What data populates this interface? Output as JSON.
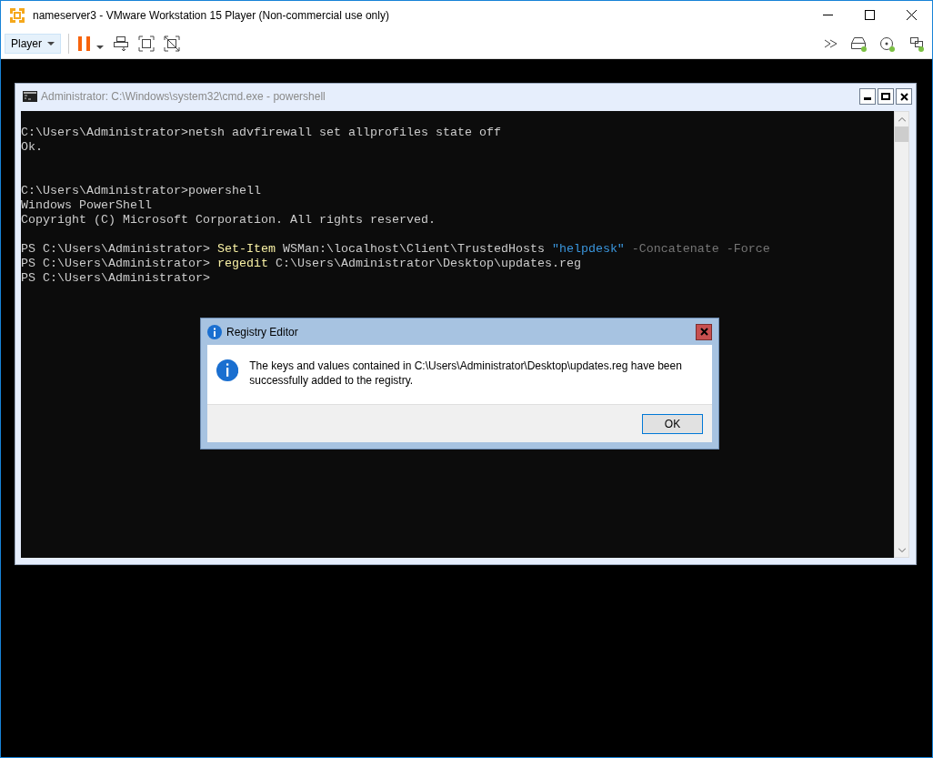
{
  "window": {
    "title": "nameserver3 - VMware Workstation 15 Player (Non-commercial use only)"
  },
  "toolbar": {
    "menu_label": "Player"
  },
  "console_window": {
    "title": "Administrator: C:\\Windows\\system32\\cmd.exe - powershell",
    "lines": [
      {
        "kind": "blank"
      },
      {
        "kind": "text",
        "segments": [
          {
            "text": "C:\\Users\\Administrator>netsh advfirewall set allprofiles state off",
            "kind": "plain"
          }
        ]
      },
      {
        "kind": "text",
        "segments": [
          {
            "text": "Ok.",
            "kind": "plain"
          }
        ]
      },
      {
        "kind": "blank"
      },
      {
        "kind": "blank"
      },
      {
        "kind": "text",
        "segments": [
          {
            "text": "C:\\Users\\Administrator>powershell",
            "kind": "plain"
          }
        ]
      },
      {
        "kind": "text",
        "segments": [
          {
            "text": "Windows PowerShell",
            "kind": "plain"
          }
        ]
      },
      {
        "kind": "text",
        "segments": [
          {
            "text": "Copyright (C) Microsoft Corporation. All rights reserved.",
            "kind": "plain"
          }
        ]
      },
      {
        "kind": "blank"
      },
      {
        "kind": "text",
        "segments": [
          {
            "text": "PS C:\\Users\\Administrator> ",
            "kind": "plain"
          },
          {
            "text": "Set-Item",
            "kind": "command"
          },
          {
            "text": " WSMan:\\localhost\\Client\\TrustedHosts ",
            "kind": "plain"
          },
          {
            "text": "\"helpdesk\"",
            "kind": "string"
          },
          {
            "text": " -Concatenate -Force",
            "kind": "parameter"
          }
        ]
      },
      {
        "kind": "text",
        "segments": [
          {
            "text": "PS C:\\Users\\Administrator> ",
            "kind": "plain"
          },
          {
            "text": "regedit",
            "kind": "command"
          },
          {
            "text": " C:\\Users\\Administrator\\Desktop\\updates.reg",
            "kind": "plain"
          }
        ]
      },
      {
        "kind": "text",
        "segments": [
          {
            "text": "PS C:\\Users\\Administrator>",
            "kind": "plain"
          }
        ]
      }
    ]
  },
  "dialog": {
    "title": "Registry Editor",
    "message": "The keys and values contained in C:\\Users\\Administrator\\Desktop\\updates.reg have been successfully added to the registry.",
    "buttons": [
      "OK"
    ]
  }
}
